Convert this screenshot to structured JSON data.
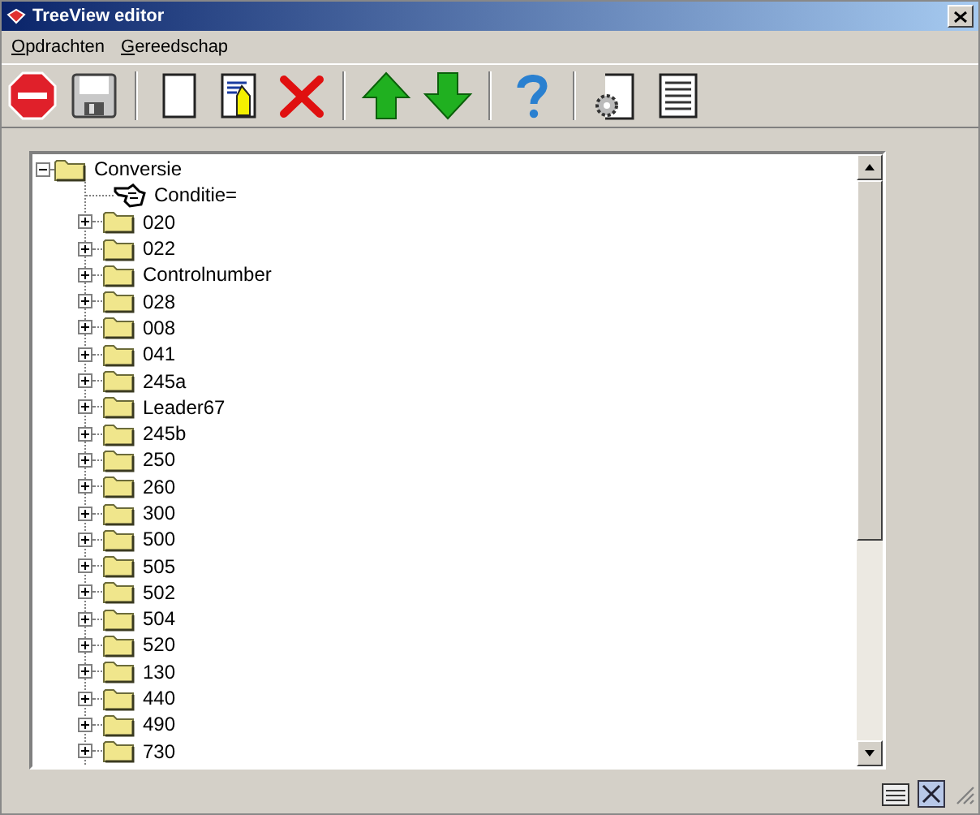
{
  "window": {
    "title": "TreeView editor"
  },
  "menu": [
    "Opdrachten",
    "Gereedschap"
  ],
  "toolbar": [
    {
      "kind": "stop"
    },
    {
      "kind": "save"
    },
    {
      "kind": "separator"
    },
    {
      "kind": "new"
    },
    {
      "kind": "edit"
    },
    {
      "kind": "delete"
    },
    {
      "kind": "separator"
    },
    {
      "kind": "up"
    },
    {
      "kind": "down"
    },
    {
      "kind": "separator"
    },
    {
      "kind": "help"
    },
    {
      "kind": "separator"
    },
    {
      "kind": "settings"
    },
    {
      "kind": "list"
    }
  ],
  "tree": {
    "label": "Conversie",
    "kind": "folder",
    "expanded": true,
    "children": [
      {
        "label": "Conditie=",
        "kind": "condition"
      },
      {
        "label": "020",
        "kind": "folder",
        "expanded": false
      },
      {
        "label": "022",
        "kind": "folder",
        "expanded": false
      },
      {
        "label": "Controlnumber",
        "kind": "folder",
        "expanded": false
      },
      {
        "label": "028",
        "kind": "folder",
        "expanded": false
      },
      {
        "label": "008",
        "kind": "folder",
        "expanded": false
      },
      {
        "label": "041",
        "kind": "folder",
        "expanded": false
      },
      {
        "label": "245a",
        "kind": "folder",
        "expanded": false
      },
      {
        "label": "Leader67",
        "kind": "folder",
        "expanded": false
      },
      {
        "label": "245b",
        "kind": "folder",
        "expanded": false
      },
      {
        "label": "250",
        "kind": "folder",
        "expanded": false
      },
      {
        "label": "260",
        "kind": "folder",
        "expanded": false
      },
      {
        "label": "300",
        "kind": "folder",
        "expanded": false
      },
      {
        "label": "500",
        "kind": "folder",
        "expanded": false
      },
      {
        "label": "505",
        "kind": "folder",
        "expanded": false
      },
      {
        "label": "502",
        "kind": "folder",
        "expanded": false
      },
      {
        "label": "504",
        "kind": "folder",
        "expanded": false
      },
      {
        "label": "520",
        "kind": "folder",
        "expanded": false
      },
      {
        "label": "130",
        "kind": "folder",
        "expanded": false
      },
      {
        "label": "440",
        "kind": "folder",
        "expanded": false
      },
      {
        "label": "490",
        "kind": "folder",
        "expanded": false
      },
      {
        "label": "730",
        "kind": "folder",
        "expanded": false
      }
    ]
  }
}
